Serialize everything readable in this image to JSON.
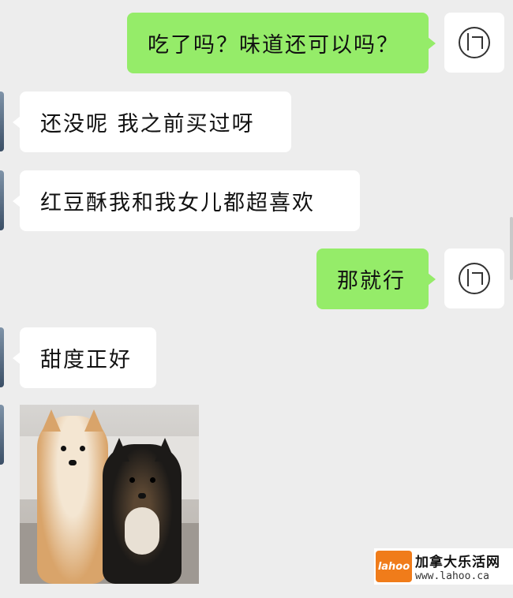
{
  "messages": [
    {
      "dir": "out",
      "text": "吃了吗？味道还可以吗？"
    },
    {
      "dir": "in",
      "text": "还没呢 我之前买过呀"
    },
    {
      "dir": "in",
      "text": "红豆酥我和我女儿都超喜欢"
    },
    {
      "dir": "out",
      "text": "那就行"
    },
    {
      "dir": "in",
      "text": "甜度正好"
    }
  ],
  "image_message": {
    "dir": "in",
    "subject": "two shiba inu dogs"
  },
  "icons": {
    "self_avatar": "logo-seal-icon",
    "other_avatar": "user-avatar"
  },
  "watermark": {
    "logo_text": "lahoo",
    "site_name": "加拿大乐活网",
    "url": "www.lahoo.ca"
  },
  "colors": {
    "background": "#ededed",
    "outgoing_bubble": "#95ec69",
    "incoming_bubble": "#ffffff",
    "watermark_orange": "#f07c1a"
  }
}
